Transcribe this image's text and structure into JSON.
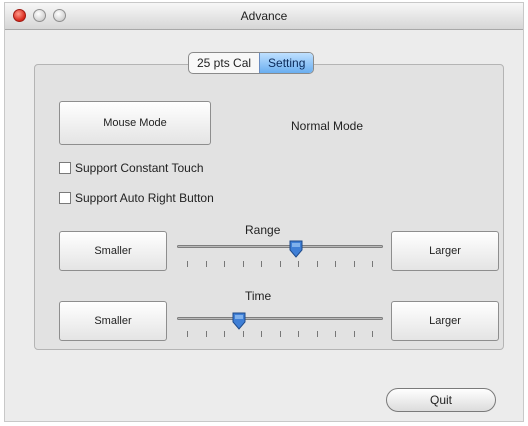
{
  "window": {
    "title": "Advance"
  },
  "tabs": [
    {
      "label": "25 pts Cal",
      "active": false
    },
    {
      "label": "Setting",
      "active": true
    }
  ],
  "mode": {
    "button_label": "Mouse Mode",
    "current_label": "Normal Mode"
  },
  "checkboxes": [
    {
      "label": "Support Constant Touch",
      "checked": false
    },
    {
      "label": "Support Auto Right Button",
      "checked": false
    }
  ],
  "range": {
    "label": "Range",
    "smaller_label": "Smaller",
    "larger_label": "Larger",
    "value_fraction": 0.58
  },
  "time": {
    "label": "Time",
    "smaller_label": "Smaller",
    "larger_label": "Larger",
    "value_fraction": 0.3
  },
  "quit_label": "Quit",
  "colors": {
    "accent_tab": "#6aaef0",
    "knob": "#3f7fd6",
    "close_button": "#d8261a"
  }
}
